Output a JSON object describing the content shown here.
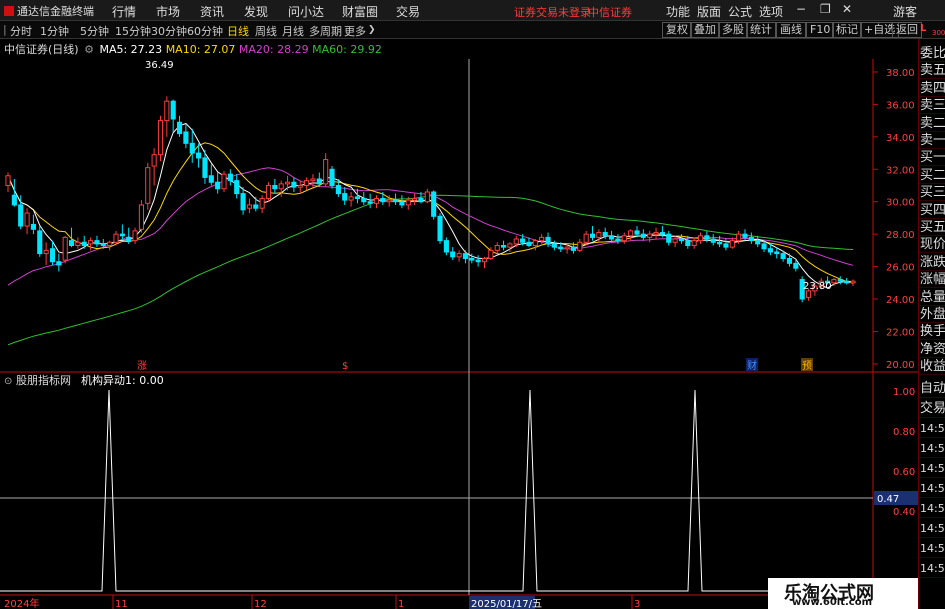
{
  "app": {
    "title": "通达信金融终端",
    "menu": [
      "行情",
      "市场",
      "资讯",
      "发现",
      "问小达",
      "财富圈",
      "交易"
    ],
    "status_login": "证券交易未登录",
    "broker": "中信证券",
    "right_menu": [
      "功能",
      "版面",
      "公式",
      "选项"
    ],
    "user": "游客"
  },
  "periods": [
    "分时",
    "1分钟",
    "5分钟",
    "15分钟",
    "30分钟",
    "60分钟",
    "日线",
    "周线",
    "月线",
    "多周期",
    "更多"
  ],
  "active_period": "日线",
  "tools": [
    "复权",
    "叠加",
    "多股",
    "统计",
    "画线",
    "F10",
    "标记",
    "+自选",
    "返回"
  ],
  "legend": {
    "stock": "中信证券(日线)",
    "ma5": "MA5: 27.23",
    "ma10": "MA10: 27.07",
    "ma20": "MA20: 28.29",
    "ma60": "MA60: 29.92"
  },
  "colors": {
    "up": "#ff3c3c",
    "down": "#00e5ff",
    "ma5": "#ffffff",
    "ma10": "#ffd700",
    "ma20": "#d040d0",
    "ma60": "#30c030",
    "axis": "#c01010"
  },
  "price_axis": [
    "38.00",
    "36.00",
    "34.00",
    "32.00",
    "30.00",
    "28.00",
    "26.00",
    "24.00",
    "22.00",
    "20.00"
  ],
  "high_mark": "36.49",
  "low_mark": "23.80",
  "event_marks": [
    {
      "text": "涨"
    },
    {
      "text": "$"
    },
    {
      "text": "财"
    },
    {
      "text": "预"
    }
  ],
  "indicator": {
    "title": "股朋指标网",
    "name": "机构异动1: 0.00",
    "axis": [
      "1.00",
      "0.80",
      "0.60",
      "0.40"
    ],
    "current": "0.47"
  },
  "time_axis": [
    "2024年",
    "11",
    "12",
    "1",
    "2025/01/17/五",
    "3"
  ],
  "right_panel": [
    "委比",
    "卖五",
    "卖四",
    "卖三",
    "卖二",
    "卖一",
    "买一",
    "买二",
    "买三",
    "买四",
    "买五",
    "现价",
    "涨跌",
    "涨幅",
    "总量",
    "外盘",
    "换手",
    "净资",
    "收益"
  ],
  "right_panel_indicator": [
    "自动",
    "交易",
    "14:56",
    "14:56",
    "14:56",
    "14:56",
    "14:56",
    "14:56",
    "14:56",
    "14:56"
  ],
  "corner": {
    "l": "L",
    "num": "300"
  },
  "watermark": {
    "title": "乐淘公式网",
    "url": "www.60lt.com"
  },
  "chart_data": {
    "type": "candlestick",
    "ylim": [
      19.5,
      38.8
    ],
    "candles": [
      [
        31.0,
        31.8,
        30.6,
        31.6
      ],
      [
        30.4,
        31.4,
        29.7,
        29.8
      ],
      [
        29.8,
        30.4,
        28.3,
        28.5
      ],
      [
        28.5,
        29.6,
        28.0,
        29.3
      ],
      [
        28.6,
        29.2,
        28.0,
        28.3
      ],
      [
        28.2,
        28.5,
        26.6,
        26.8
      ],
      [
        26.8,
        27.5,
        26.1,
        27.0
      ],
      [
        27.1,
        27.6,
        26.1,
        26.3
      ],
      [
        26.3,
        26.8,
        25.7,
        26.1
      ],
      [
        26.4,
        27.9,
        26.2,
        27.8
      ],
      [
        27.6,
        28.4,
        27.2,
        27.3
      ],
      [
        27.3,
        27.8,
        27.1,
        27.5
      ],
      [
        27.5,
        27.9,
        27.1,
        27.3
      ],
      [
        27.4,
        27.8,
        27.0,
        27.6
      ],
      [
        27.6,
        27.9,
        27.2,
        27.4
      ],
      [
        27.4,
        27.7,
        27.1,
        27.3
      ],
      [
        27.3,
        27.6,
        27.0,
        27.5
      ],
      [
        27.5,
        28.2,
        27.3,
        28.0
      ],
      [
        28.0,
        28.6,
        27.7,
        27.9
      ],
      [
        27.8,
        28.4,
        27.4,
        27.6
      ],
      [
        27.6,
        28.4,
        27.4,
        28.2
      ],
      [
        28.3,
        30.1,
        28.1,
        29.8
      ],
      [
        29.9,
        32.4,
        29.5,
        32.1
      ],
      [
        32.2,
        33.3,
        31.0,
        32.9
      ],
      [
        32.9,
        35.3,
        32.5,
        35.0
      ],
      [
        35.0,
        36.5,
        34.0,
        36.2
      ],
      [
        36.2,
        36.3,
        34.3,
        35.1
      ],
      [
        34.9,
        35.3,
        34.0,
        34.2
      ],
      [
        34.3,
        34.8,
        33.3,
        33.6
      ],
      [
        33.6,
        34.5,
        32.4,
        33.0
      ],
      [
        33.0,
        33.6,
        32.1,
        32.7
      ],
      [
        32.7,
        33.2,
        31.1,
        31.5
      ],
      [
        31.6,
        32.3,
        31.0,
        31.2
      ],
      [
        31.2,
        31.8,
        30.5,
        30.8
      ],
      [
        30.8,
        31.9,
        30.6,
        31.7
      ],
      [
        31.7,
        32.0,
        31.0,
        31.3
      ],
      [
        31.3,
        31.7,
        30.2,
        30.5
      ],
      [
        30.5,
        30.9,
        29.2,
        29.5
      ],
      [
        29.6,
        30.2,
        29.3,
        29.8
      ],
      [
        29.8,
        30.3,
        29.4,
        29.6
      ],
      [
        29.6,
        30.4,
        29.3,
        30.2
      ],
      [
        30.2,
        31.2,
        30.0,
        31.0
      ],
      [
        31.0,
        31.4,
        30.5,
        30.8
      ],
      [
        30.8,
        31.3,
        30.3,
        31.1
      ],
      [
        31.1,
        31.6,
        30.7,
        31.2
      ],
      [
        31.2,
        31.5,
        30.6,
        30.9
      ],
      [
        30.9,
        31.3,
        30.5,
        31.0
      ],
      [
        31.0,
        31.5,
        30.7,
        31.3
      ],
      [
        31.3,
        31.7,
        30.9,
        31.4
      ],
      [
        31.4,
        31.8,
        30.9,
        31.1
      ],
      [
        31.1,
        33.0,
        30.9,
        32.6
      ],
      [
        32.0,
        32.2,
        30.8,
        31.0
      ],
      [
        31.0,
        31.4,
        30.3,
        30.5
      ],
      [
        30.5,
        30.9,
        29.8,
        30.1
      ],
      [
        30.1,
        30.6,
        29.7,
        30.3
      ],
      [
        30.3,
        30.8,
        29.9,
        30.2
      ],
      [
        30.2,
        30.6,
        29.8,
        30.0
      ],
      [
        30.0,
        30.5,
        29.6,
        29.9
      ],
      [
        29.9,
        30.4,
        29.6,
        30.2
      ],
      [
        30.2,
        30.6,
        29.8,
        30.0
      ],
      [
        30.0,
        30.4,
        29.7,
        30.1
      ],
      [
        30.1,
        30.5,
        29.8,
        30.0
      ],
      [
        30.0,
        30.4,
        29.6,
        29.8
      ],
      [
        29.8,
        30.3,
        29.5,
        30.1
      ],
      [
        30.1,
        30.5,
        29.8,
        30.2
      ],
      [
        30.2,
        30.6,
        29.9,
        30.0
      ],
      [
        30.0,
        30.8,
        29.9,
        30.6
      ],
      [
        30.6,
        30.7,
        28.9,
        29.1
      ],
      [
        29.1,
        29.3,
        27.4,
        27.6
      ],
      [
        27.6,
        27.8,
        26.7,
        26.9
      ],
      [
        26.9,
        27.2,
        26.4,
        26.6
      ],
      [
        26.6,
        27.0,
        26.3,
        26.8
      ],
      [
        26.8,
        27.0,
        26.2,
        26.5
      ],
      [
        26.5,
        26.8,
        26.2,
        26.4
      ],
      [
        26.4,
        26.7,
        26.0,
        26.3
      ],
      [
        26.3,
        26.6,
        25.9,
        26.5
      ],
      [
        26.5,
        27.2,
        26.4,
        27.0
      ],
      [
        27.0,
        27.5,
        26.8,
        27.3
      ],
      [
        27.3,
        27.6,
        27.0,
        27.2
      ],
      [
        27.2,
        27.5,
        26.9,
        27.4
      ],
      [
        27.4,
        27.9,
        27.2,
        27.7
      ],
      [
        27.7,
        28.0,
        27.3,
        27.5
      ],
      [
        27.5,
        27.8,
        27.2,
        27.3
      ],
      [
        27.3,
        27.7,
        27.0,
        27.6
      ],
      [
        27.6,
        28.0,
        27.4,
        27.8
      ],
      [
        27.8,
        28.1,
        27.2,
        27.4
      ],
      [
        27.4,
        27.6,
        27.0,
        27.2
      ],
      [
        27.2,
        27.5,
        26.9,
        27.1
      ],
      [
        27.1,
        27.4,
        26.8,
        27.2
      ],
      [
        27.2,
        27.5,
        26.8,
        27.0
      ],
      [
        27.0,
        27.7,
        26.9,
        27.5
      ],
      [
        27.5,
        28.2,
        27.3,
        28.0
      ],
      [
        28.0,
        28.5,
        27.6,
        27.8
      ],
      [
        27.8,
        28.3,
        27.5,
        28.1
      ],
      [
        28.1,
        28.4,
        27.7,
        27.9
      ],
      [
        27.9,
        28.2,
        27.5,
        27.7
      ],
      [
        27.7,
        28.0,
        27.4,
        27.6
      ],
      [
        27.6,
        28.1,
        27.4,
        27.9
      ],
      [
        27.9,
        28.3,
        27.6,
        28.2
      ],
      [
        28.2,
        28.5,
        27.8,
        28.0
      ],
      [
        28.0,
        28.3,
        27.6,
        27.8
      ],
      [
        27.8,
        28.2,
        27.5,
        28.0
      ],
      [
        28.0,
        28.4,
        27.7,
        28.1
      ],
      [
        28.1,
        28.5,
        27.8,
        28.0
      ],
      [
        28.0,
        28.2,
        27.3,
        27.5
      ],
      [
        27.5,
        27.9,
        27.2,
        27.7
      ],
      [
        27.7,
        28.0,
        27.4,
        27.6
      ],
      [
        27.6,
        27.9,
        27.1,
        27.3
      ],
      [
        27.3,
        27.8,
        27.1,
        27.6
      ],
      [
        27.6,
        28.1,
        27.4,
        27.9
      ],
      [
        27.9,
        28.2,
        27.5,
        27.7
      ],
      [
        27.7,
        28.0,
        27.3,
        27.5
      ],
      [
        27.5,
        27.9,
        27.2,
        27.4
      ],
      [
        27.4,
        27.7,
        27.0,
        27.2
      ],
      [
        27.2,
        27.8,
        27.1,
        27.6
      ],
      [
        27.6,
        28.2,
        27.4,
        28.0
      ],
      [
        28.0,
        28.3,
        27.6,
        27.8
      ],
      [
        27.8,
        28.1,
        27.4,
        27.6
      ],
      [
        27.6,
        27.9,
        27.2,
        27.4
      ],
      [
        27.4,
        27.6,
        26.9,
        27.1
      ],
      [
        27.1,
        27.4,
        26.7,
        26.9
      ],
      [
        26.9,
        27.2,
        26.5,
        26.8
      ],
      [
        26.8,
        27.0,
        26.3,
        26.5
      ],
      [
        26.5,
        26.8,
        26.0,
        26.2
      ],
      [
        26.2,
        26.4,
        25.7,
        25.9
      ],
      [
        25.2,
        25.4,
        23.8,
        24.0
      ],
      [
        24.1,
        24.6,
        23.9,
        24.5
      ],
      [
        24.5,
        25.0,
        24.2,
        24.8
      ],
      [
        24.8,
        25.3,
        24.6,
        25.1
      ],
      [
        25.1,
        25.4,
        24.9,
        25.0
      ],
      [
        25.0,
        25.3,
        24.8,
        25.2
      ],
      [
        25.2,
        25.4,
        24.9,
        25.1
      ],
      [
        25.1,
        25.3,
        24.9,
        25.0
      ],
      [
        25.0,
        25.2,
        24.8,
        25.1
      ]
    ],
    "indicator_spikes_at": [
      14,
      72,
      95
    ]
  }
}
